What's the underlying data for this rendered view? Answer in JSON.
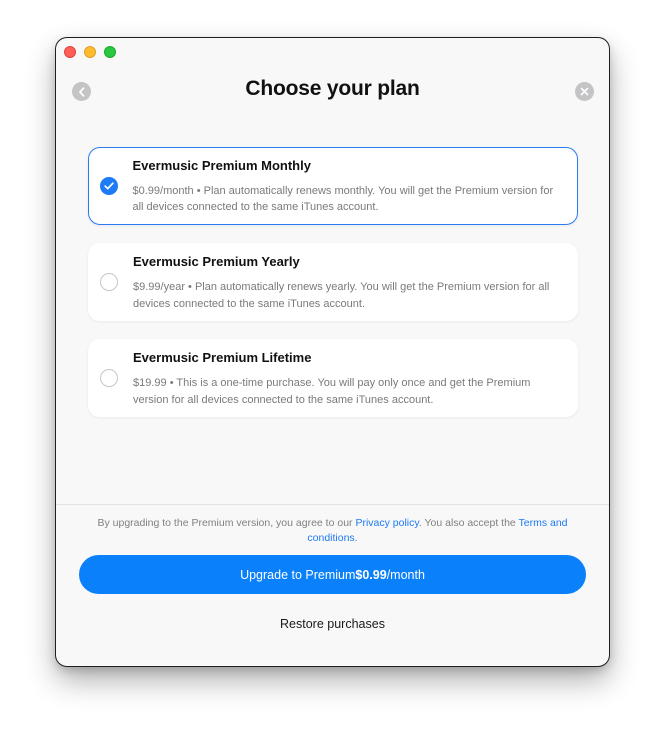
{
  "window": {
    "title": "Choose your plan",
    "back_icon": "chevron-left-icon",
    "close_icon": "close-icon"
  },
  "plans": [
    {
      "name": "Evermusic Premium Monthly",
      "description": "$0.99/month • Plan automatically renews monthly. You will get the Premium version for all devices connected to the same iTunes account.",
      "selected": true
    },
    {
      "name": "Evermusic Premium Yearly",
      "description": "$9.99/year • Plan automatically renews yearly. You will get the Premium version for all devices connected to the same iTunes account.",
      "selected": false
    },
    {
      "name": "Evermusic Premium Lifetime",
      "description": "$19.99 • This is a one-time purchase. You will pay only once and get the Premium version for all devices connected to the same iTunes account.",
      "selected": false
    }
  ],
  "legal": {
    "prefix": "By upgrading to the Premium version, you agree to our ",
    "privacy_link": "Privacy policy",
    "middle": ". You also accept the ",
    "terms_link": "Terms and conditions",
    "suffix": "."
  },
  "upgrade_button": {
    "prefix": "Upgrade to Premium ",
    "price": "$0.99",
    "period": "/month"
  },
  "restore_label": "Restore purchases",
  "colors": {
    "accent": "#0a80fb",
    "selected_border": "#2b7bf3",
    "link": "#1e7af5"
  }
}
